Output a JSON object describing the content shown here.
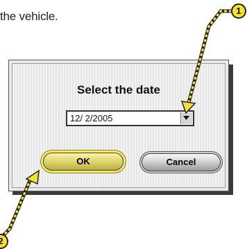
{
  "caption": {
    "text": "the vehicle."
  },
  "dialog": {
    "title": "Select the date",
    "date_value": "12/ 2/2005",
    "ok_label": "OK",
    "cancel_label": "Cancel"
  },
  "callouts": [
    {
      "number": "1"
    },
    {
      "number": "2"
    }
  ],
  "colors": {
    "callout_fill": "#f5e230",
    "ok_button": "#e8dd70",
    "cancel_button": "#c9c9c9",
    "dialog_bg": "#ebebeb"
  },
  "icons": {
    "combo_arrow": "chevron-down-icon",
    "callout_marker": "callout-number-icon"
  }
}
